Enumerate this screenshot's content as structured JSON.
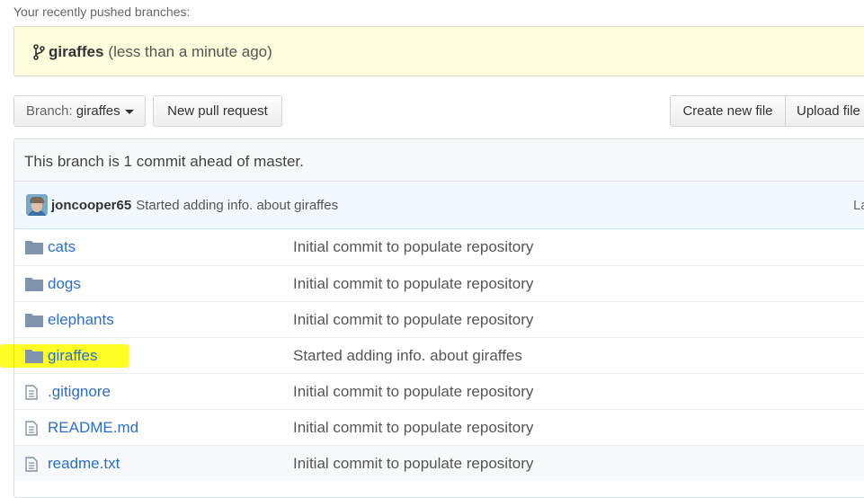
{
  "recent": {
    "title": "Your recently pushed branches:",
    "branch": "giraffes",
    "time": "(less than a minute ago)"
  },
  "toolbar": {
    "branch_label": "Branch:",
    "branch_value": "giraffes",
    "new_pr": "New pull request",
    "create_file": "Create new file",
    "upload_file": "Upload file"
  },
  "status": {
    "ahead": "This branch is 1 commit ahead of master."
  },
  "commit": {
    "author": "joncooper65",
    "message": "Started adding info. about giraffes",
    "latest": "La"
  },
  "files": [
    {
      "name": "cats",
      "type": "folder",
      "message": "Initial commit to populate repository"
    },
    {
      "name": "dogs",
      "type": "folder",
      "message": "Initial commit to populate repository"
    },
    {
      "name": "elephants",
      "type": "folder",
      "message": "Initial commit to populate repository"
    },
    {
      "name": "giraffes",
      "type": "folder",
      "message": "Started adding info. about giraffes"
    },
    {
      "name": ".gitignore",
      "type": "file",
      "message": "Initial commit to populate repository"
    },
    {
      "name": "README.md",
      "type": "file",
      "message": "Initial commit to populate repository"
    },
    {
      "name": "readme.txt",
      "type": "file",
      "message": "Initial commit to populate repository"
    }
  ],
  "colors": {
    "link": "#2a6fc9",
    "folder_icon": "#8094ae",
    "highlight": "#ffff00",
    "banner": "#fffbdd"
  }
}
